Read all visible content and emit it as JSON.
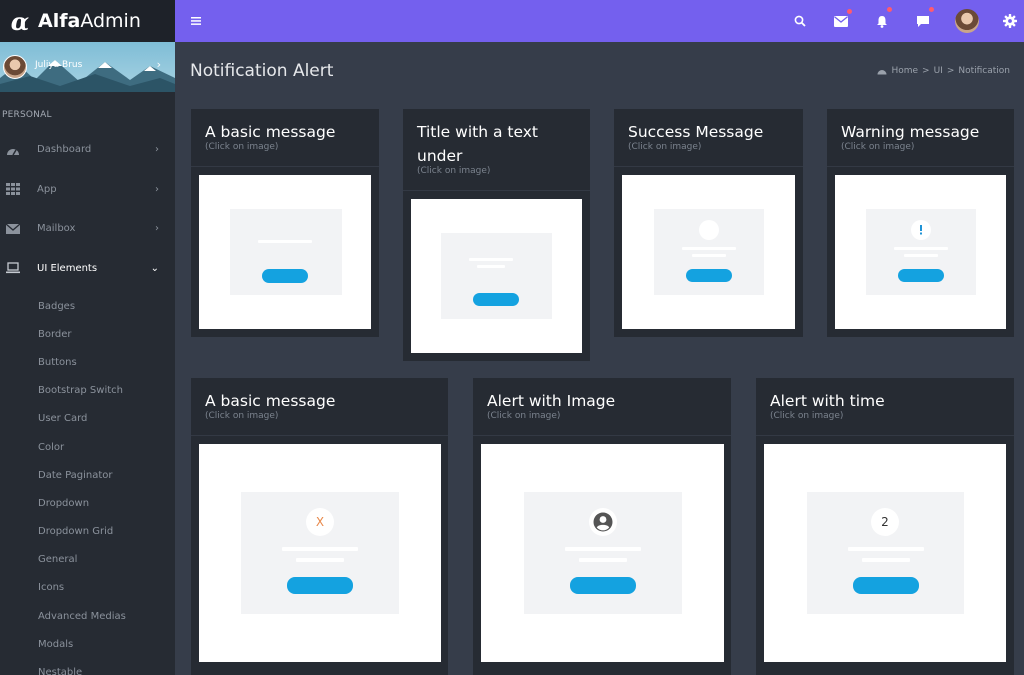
{
  "brand": {
    "logo": "α",
    "name_bold": "Alfa",
    "name_light": "Admin"
  },
  "user": {
    "name": "Juliya Brus"
  },
  "sidebar": {
    "section": "PERSONAL",
    "items": [
      {
        "label": "Dashboard",
        "icon": "dashboard-icon"
      },
      {
        "label": "App",
        "icon": "grid-icon"
      },
      {
        "label": "Mailbox",
        "icon": "mail-icon"
      },
      {
        "label": "UI Elements",
        "icon": "laptop-icon"
      }
    ],
    "sub_items": [
      "Badges",
      "Border",
      "Buttons",
      "Bootstrap Switch",
      "User Card",
      "Color",
      "Date Paginator",
      "Dropdown",
      "Dropdown Grid",
      "General",
      "Icons",
      "Advanced Medias",
      "Modals",
      "Nestable"
    ]
  },
  "topbar": {
    "icons": [
      "menu-icon",
      "search-icon",
      "mail-icon",
      "bell-icon",
      "chat-icon",
      "avatar",
      "gear-icon"
    ]
  },
  "page": {
    "title": "Notification Alert"
  },
  "breadcrumb": {
    "home": "Home",
    "sep": ">",
    "ui": "UI",
    "current": "Notification"
  },
  "cards": [
    {
      "title": "A basic message",
      "sub": "(Click on image)"
    },
    {
      "title": "Title with a text under",
      "sub": "(Click on image)"
    },
    {
      "title": "Success Message",
      "sub": "(Click on image)"
    },
    {
      "title": "Warning message",
      "sub": "(Click on image)"
    },
    {
      "title": "A basic message",
      "sub": "(Click on image)",
      "badge": "X"
    },
    {
      "title": "Alert with Image",
      "sub": "(Click on image)"
    },
    {
      "title": "Alert with time",
      "sub": "(Click on image)",
      "badge": "2"
    }
  ],
  "colors": {
    "accent": "#7460ee",
    "button": "#14a2e0",
    "sidebar": "#262b33",
    "content": "#363d4a"
  }
}
